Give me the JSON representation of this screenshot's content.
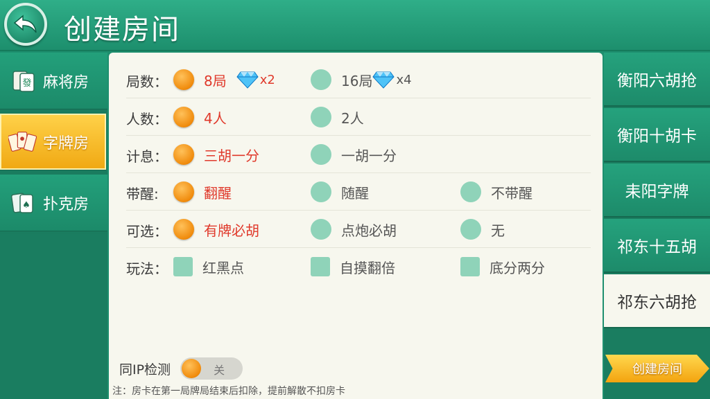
{
  "header": {
    "title": "创建房间",
    "back_icon": "back-arrow-icon"
  },
  "sidebar": {
    "items": [
      {
        "label": "麻将房",
        "icon": "mahjong-tile-icon",
        "active": false
      },
      {
        "label": "字牌房",
        "icon": "zipai-cards-icon",
        "active": true
      },
      {
        "label": "扑克房",
        "icon": "poker-cards-icon",
        "active": false
      }
    ]
  },
  "options": {
    "rounds": {
      "label": "局数：",
      "choices": [
        {
          "text": "8局",
          "multiplier": "x2",
          "selected": true
        },
        {
          "text": "16局",
          "multiplier": "x4",
          "selected": false
        }
      ]
    },
    "players": {
      "label": "人数：",
      "choices": [
        {
          "text": "4人",
          "selected": true
        },
        {
          "text": "2人",
          "selected": false
        }
      ]
    },
    "scoring": {
      "label": "计息：",
      "choices": [
        {
          "text": "三胡一分",
          "selected": true
        },
        {
          "text": "一胡一分",
          "selected": false
        }
      ]
    },
    "xing": {
      "label": "带醒:",
      "choices": [
        {
          "text": "翻醒",
          "selected": true
        },
        {
          "text": "随醒",
          "selected": false
        },
        {
          "text": "不带醒",
          "selected": false
        }
      ]
    },
    "optional": {
      "label": "可选：",
      "choices": [
        {
          "text": "有牌必胡",
          "selected": true
        },
        {
          "text": "点炮必胡",
          "selected": false
        },
        {
          "text": "无",
          "selected": false
        }
      ]
    },
    "rules": {
      "label": "玩法：",
      "choices": [
        {
          "text": "红黑点",
          "checked": false
        },
        {
          "text": "自摸翻倍",
          "checked": false
        },
        {
          "text": "底分两分",
          "checked": false
        }
      ]
    }
  },
  "ip_check": {
    "label": "同IP检测",
    "state": "关"
  },
  "note": "注：房卡在第一局牌局结束后扣除，提前解散不扣房卡",
  "games": [
    {
      "label": "衡阳六胡抢",
      "active": false
    },
    {
      "label": "衡阳十胡卡",
      "active": false
    },
    {
      "label": "耒阳字牌",
      "active": false
    },
    {
      "label": "祁东十五胡",
      "active": false
    },
    {
      "label": "祁东六胡抢",
      "active": true
    }
  ],
  "create_button": "创建房间",
  "colors": {
    "accent": "#f08b0c",
    "selected_text": "#e0392b",
    "header_green": "#1d8f6d",
    "panel_bg": "#f7f7ee",
    "radio_off": "#8fd3b9"
  }
}
